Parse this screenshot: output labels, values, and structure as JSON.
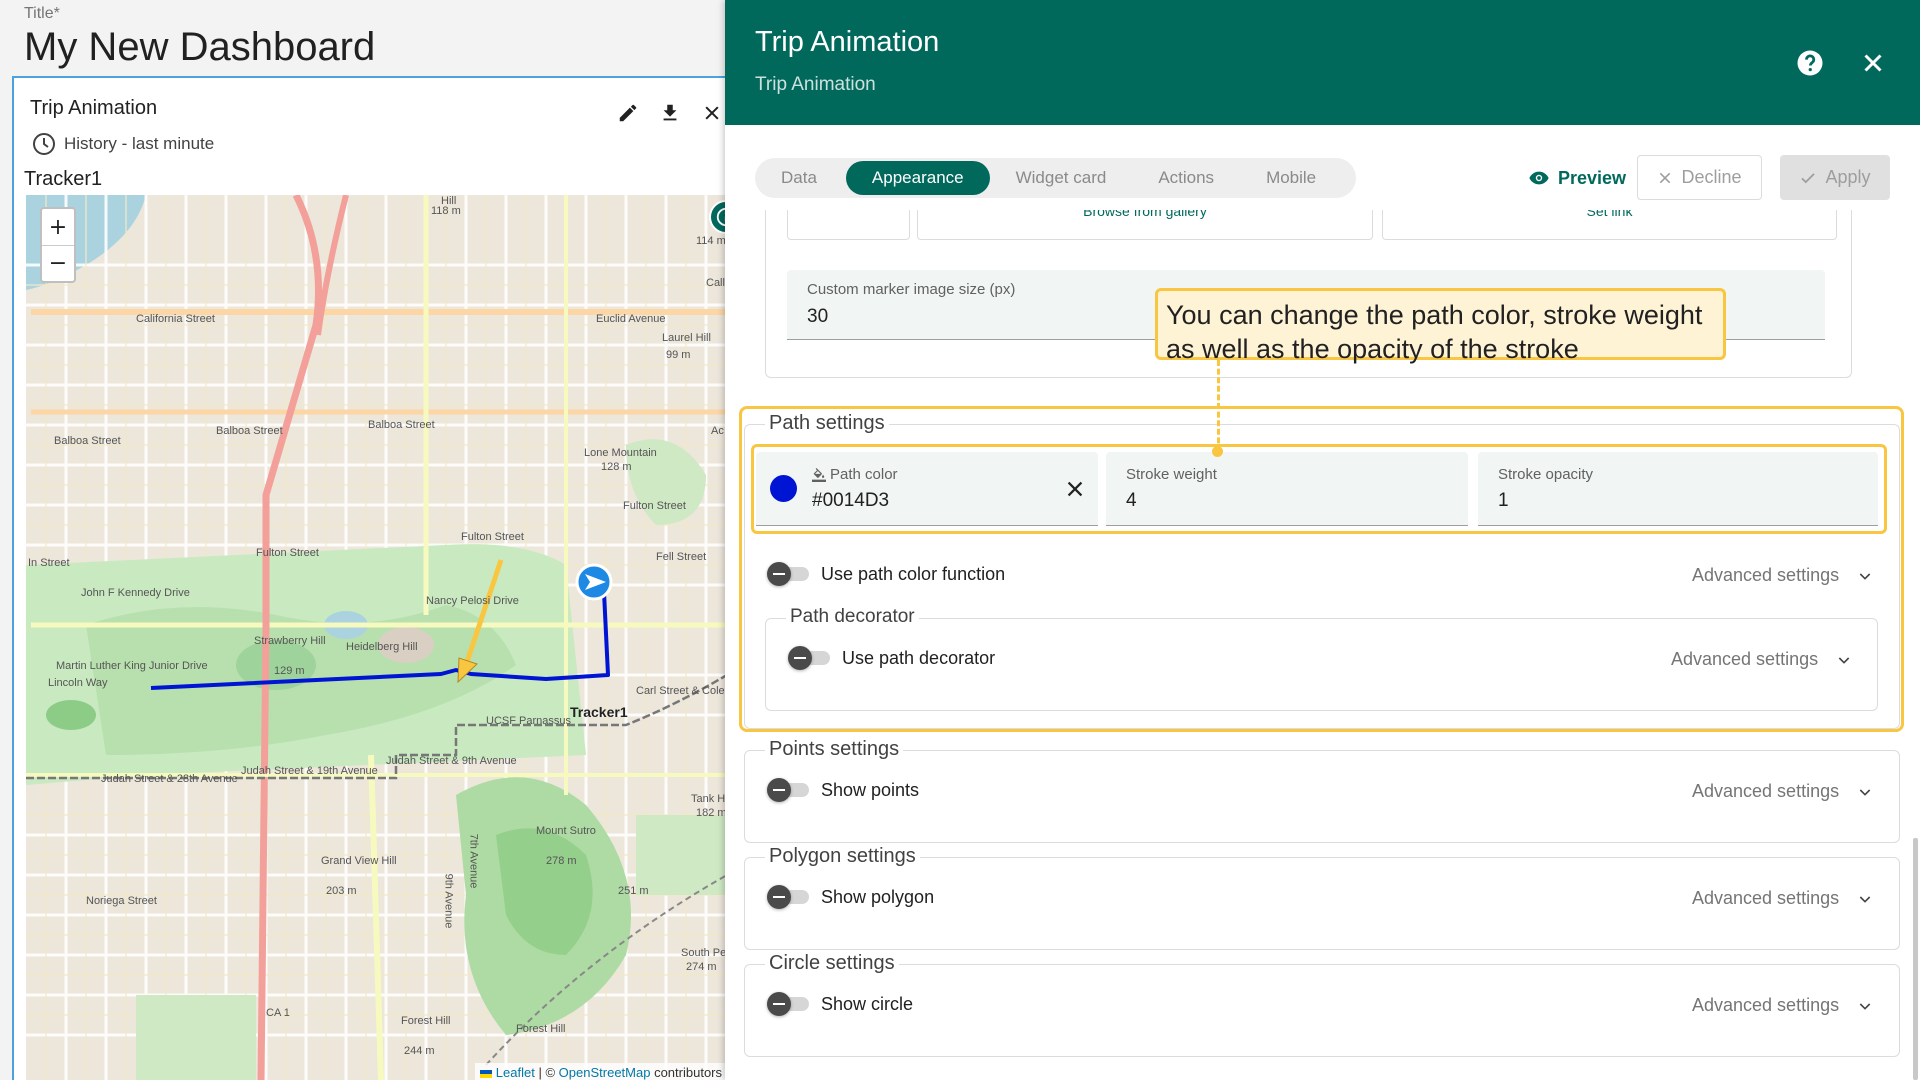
{
  "dashboard": {
    "title_label": "Title*",
    "title": "My New Dashboard"
  },
  "widget": {
    "title": "Trip Animation",
    "timewindow": "History - last minute",
    "tracker_label": "Tracker1",
    "actions": [
      "edit-icon",
      "download-icon",
      "close-icon"
    ]
  },
  "map": {
    "zoom_in": "+",
    "zoom_out": "−",
    "tracker_name": "Tracker1",
    "path_color": "#0014D3",
    "attribution": {
      "leaflet": "Leaflet",
      "separator": "| ©",
      "osm": "OpenStreetMap",
      "suffix": "contributors"
    },
    "streets": [
      "California Street",
      "Balboa Street",
      "Balboa Street",
      "Balboa Street",
      "Fulton Street",
      "Fulton Street",
      "Fulton Street",
      "Fell Street",
      "John F Kennedy Drive",
      "Martin Luther King Junior Drive",
      "Lincoln Way",
      "Nancy Pelosi Drive",
      "Euclid Avenue",
      "Lone Mountain",
      "128 m",
      "Laurel Hill",
      "99 m",
      "Strawberry Hill",
      "129 m",
      "Heidelberg Hill",
      "UCSF Parnassus",
      "Carl Street & Cole Street",
      "Judah Street & 28th Avenue",
      "Judah Street & 19th Avenue",
      "Judah Street & 9th Avenue",
      "Grand View Hill",
      "203 m",
      "Noriega Street",
      "Mount Sutro",
      "278 m",
      "Tank Hill",
      "182 m",
      "251 m",
      "South Peak",
      "274 m",
      "Forest Hill",
      "244 m",
      "Forest Hill",
      "CA 1",
      "118 m",
      "114 m",
      "9th Avenue",
      "7th Avenue",
      "In Street",
      "Hill",
      "Call",
      "Ac"
    ]
  },
  "panel": {
    "title": "Trip Animation",
    "subtitle": "Trip Animation",
    "tabs": [
      {
        "label": "Data",
        "active": false
      },
      {
        "label": "Appearance",
        "active": true
      },
      {
        "label": "Widget card",
        "active": false
      },
      {
        "label": "Actions",
        "active": false
      },
      {
        "label": "Mobile",
        "active": false
      }
    ],
    "preview": "Preview",
    "decline": "Decline",
    "apply": "Apply"
  },
  "marker": {
    "gallery_link": "Browse from gallery",
    "set_link": "Set link",
    "custom_size_label": "Custom marker image size (px)",
    "custom_size_value": "30"
  },
  "callout": {
    "text": "You can change the path color, stroke weight as well as the opacity of the stroke"
  },
  "path_settings": {
    "legend": "Path settings",
    "color_label": "Path color",
    "color_value": "#0014D3",
    "stroke_weight_label": "Stroke weight",
    "stroke_weight_value": "4",
    "stroke_opacity_label": "Stroke opacity",
    "stroke_opacity_value": "1",
    "color_function_label": "Use path color function",
    "color_function_enabled": false,
    "advanced": "Advanced settings",
    "decorator": {
      "legend": "Path decorator",
      "label": "Use path decorator",
      "enabled": false,
      "advanced": "Advanced settings"
    }
  },
  "points_settings": {
    "legend": "Points settings",
    "label": "Show points",
    "enabled": false,
    "advanced": "Advanced settings"
  },
  "polygon_settings": {
    "legend": "Polygon settings",
    "label": "Show polygon",
    "enabled": false,
    "advanced": "Advanced settings"
  },
  "circle_settings": {
    "legend": "Circle settings",
    "label": "Show circle",
    "enabled": false,
    "advanced": "Advanced settings"
  }
}
